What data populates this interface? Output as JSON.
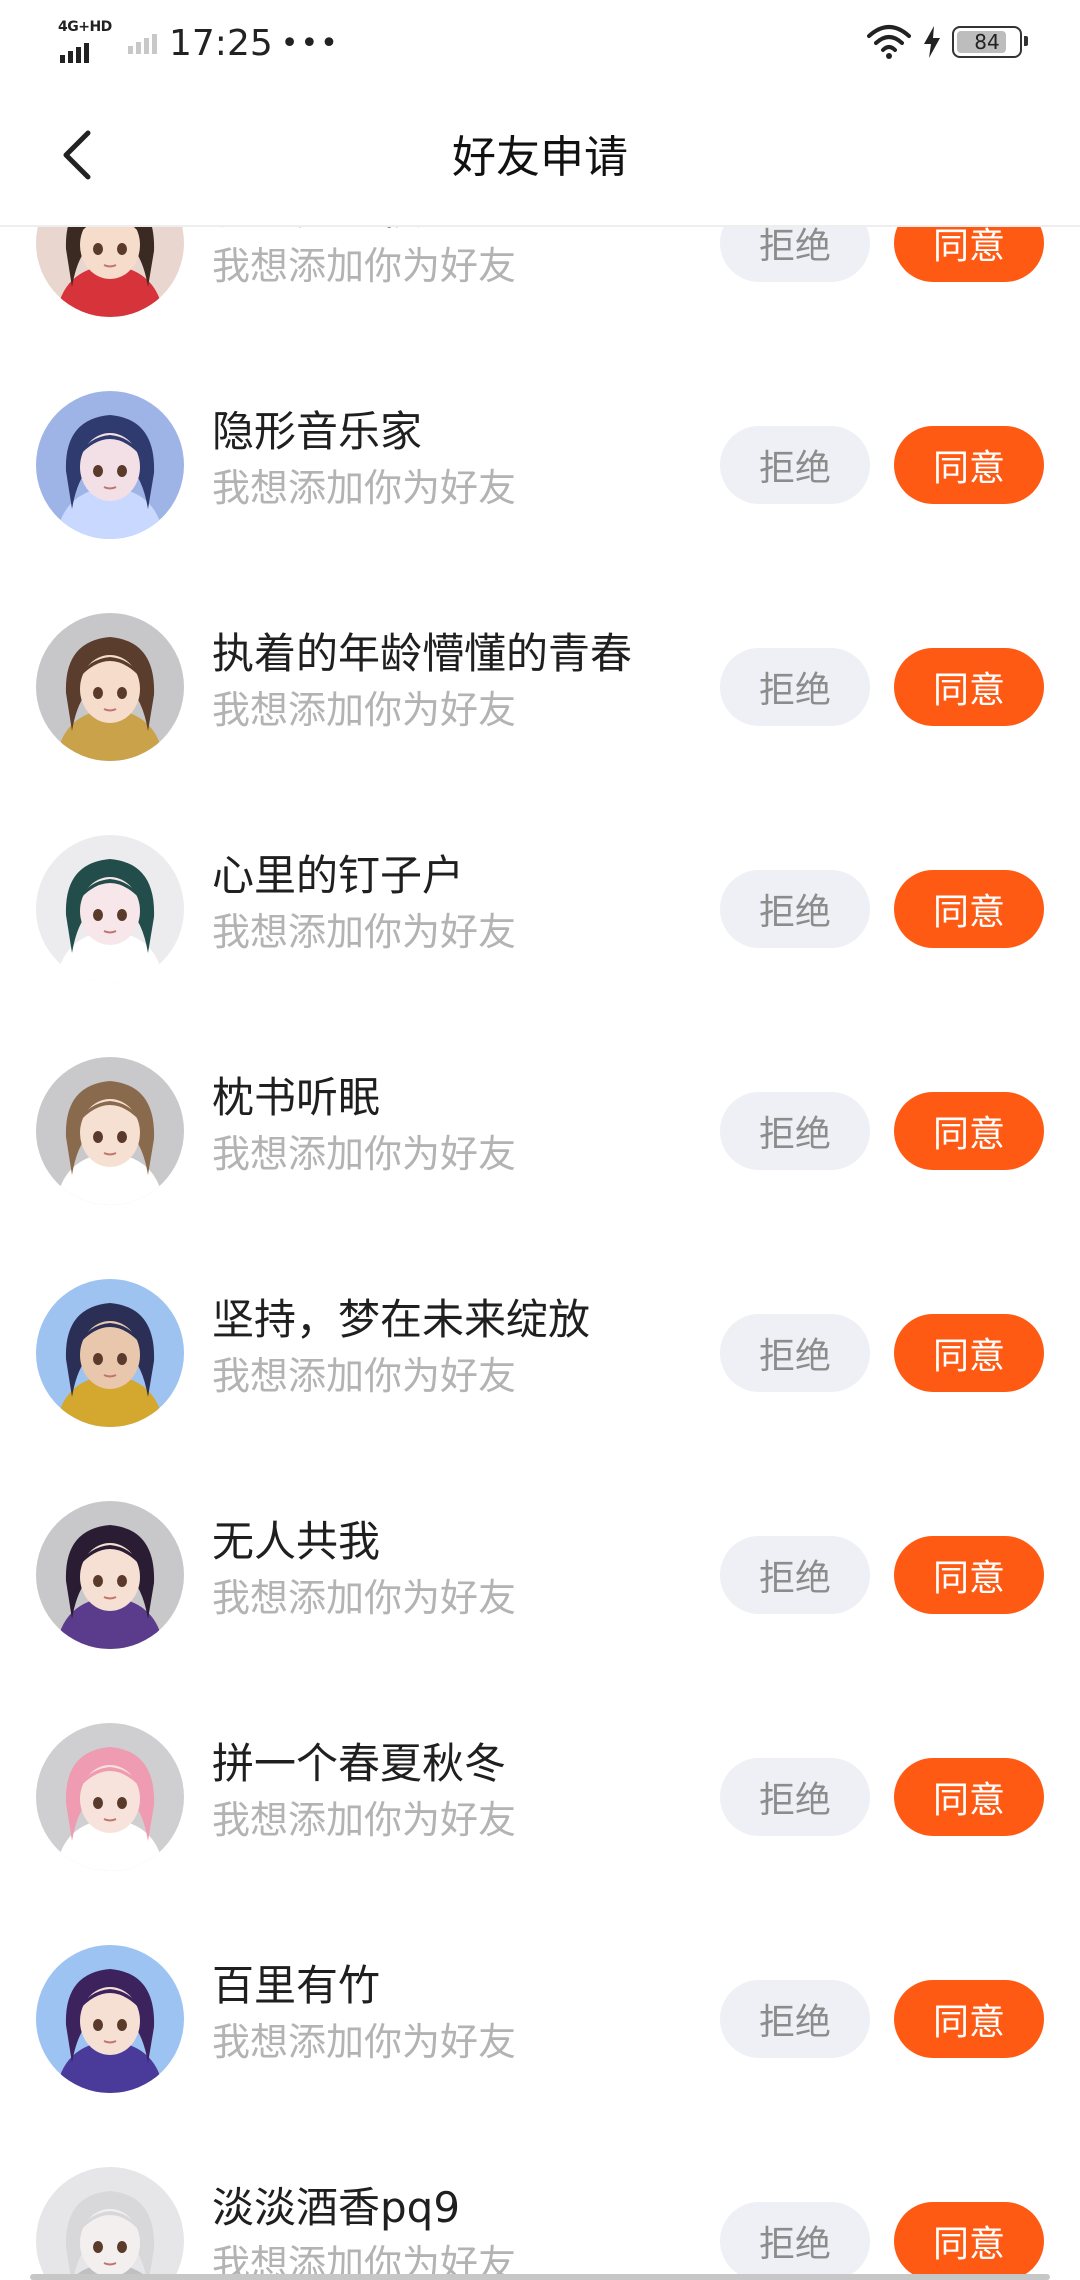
{
  "status_bar": {
    "network": "4G+HD",
    "time": "17:25",
    "dots": "•••",
    "battery": "84"
  },
  "header": {
    "title": "好友申请"
  },
  "buttons": {
    "reject": "拒绝",
    "accept": "同意"
  },
  "requests": [
    {
      "name": "长的无地很",
      "message": "我想添加你为好友",
      "avatar": {
        "bg": "#e9d7cf",
        "hair": "#3b2a22",
        "skin": "#f6dccb",
        "accent": "#d6333b"
      }
    },
    {
      "name": "隐形音乐家",
      "message": "我想添加你为好友",
      "avatar": {
        "bg": "#9fb4e6",
        "hair": "#2f3a6e",
        "skin": "#f2e0e6",
        "accent": "#c9d8ff"
      }
    },
    {
      "name": "执着的年龄懵懂的青春",
      "message": "我想添加你为好友",
      "avatar": {
        "bg": "#c7c7c9",
        "hair": "#5a3d2c",
        "skin": "#f5dccb",
        "accent": "#c9a24a"
      }
    },
    {
      "name": "心里的钉子户",
      "message": "我想添加你为好友",
      "avatar": {
        "bg": "#ecebee",
        "hair": "#234d4a",
        "skin": "#f7e6ea",
        "accent": "#ffffff"
      }
    },
    {
      "name": "枕书听眠",
      "message": "我想添加你为好友",
      "avatar": {
        "bg": "#c9c9cb",
        "hair": "#8a6a4c",
        "skin": "#f6e0d2",
        "accent": "#ffffff"
      }
    },
    {
      "name": "坚持，梦在未来绽放",
      "message": "我想添加你为好友",
      "avatar": {
        "bg": "#9ec3f0",
        "hair": "#2b2f55",
        "skin": "#e8c7ad",
        "accent": "#d4a82e"
      }
    },
    {
      "name": "无人共我",
      "message": "我想添加你为好友",
      "avatar": {
        "bg": "#c8c8ca",
        "hair": "#2a1d33",
        "skin": "#f6dfd3",
        "accent": "#5b3b8c"
      }
    },
    {
      "name": "拼一个春夏秋冬",
      "message": "我想添加你为好友",
      "avatar": {
        "bg": "#cfcfd1",
        "hair": "#ef9bb1",
        "skin": "#f8e3dc",
        "accent": "#ffffff"
      }
    },
    {
      "name": "百里有竹",
      "message": "我想添加你为好友",
      "avatar": {
        "bg": "#9cc3f2",
        "hair": "#3c235e",
        "skin": "#f6dfd3",
        "accent": "#4a3a9a"
      }
    },
    {
      "name": "淡淡酒香pq9",
      "message": "我想添加你为好友",
      "avatar": {
        "bg": "#e6e6e8",
        "hair": "#d8d8da",
        "skin": "#f4efef",
        "accent": "#bfbfc4"
      }
    }
  ],
  "colors": {
    "accept": "#ff5a14",
    "reject_bg": "#eef0f5",
    "muted_text": "#b3b3b3"
  }
}
